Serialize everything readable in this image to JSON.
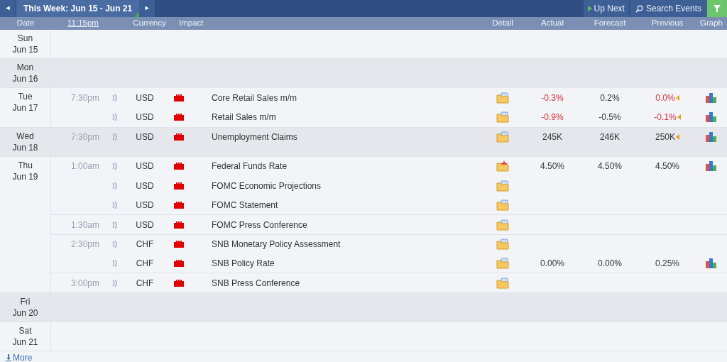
{
  "toolbar": {
    "prev": "◄",
    "week": "This Week: Jun 15 - Jun 21",
    "next": "►",
    "up_next": "Up Next",
    "search": "Search Events"
  },
  "columns": {
    "date": "Date",
    "time": "11:15pm",
    "currency": "Currency",
    "impact": "Impact",
    "detail": "Detail",
    "actual": "Actual",
    "forecast": "Forecast",
    "previous": "Previous",
    "graph": "Graph"
  },
  "days": [
    {
      "day": "Sun",
      "date": "Jun 15"
    },
    {
      "day": "Mon",
      "date": "Jun 16"
    },
    {
      "day": "Tue",
      "date": "Jun 17",
      "events": [
        {
          "time": "7:30pm",
          "currency": "USD",
          "high_impact": true,
          "title": "Core Retail Sales m/m",
          "new_detail": false,
          "actual": "-0.3%",
          "actual_worse": true,
          "forecast": "0.2%",
          "previous": "0.0%",
          "previous_worse": true,
          "revised": true,
          "graph": true
        },
        {
          "currency": "USD",
          "high_impact": true,
          "title": "Retail Sales m/m",
          "new_detail": false,
          "actual": "-0.9%",
          "actual_worse": true,
          "forecast": "-0.5%",
          "previous": "-0.1%",
          "previous_worse": true,
          "revised": true,
          "graph": true
        }
      ]
    },
    {
      "day": "Wed",
      "date": "Jun 18",
      "events": [
        {
          "time": "7:30pm",
          "currency": "USD",
          "high_impact": true,
          "title": "Unemployment Claims",
          "new_detail": false,
          "actual": "245K",
          "actual_worse": false,
          "forecast": "246K",
          "previous": "250K",
          "previous_worse": false,
          "revised": true,
          "graph": true
        }
      ]
    },
    {
      "day": "Thu",
      "date": "Jun 19",
      "events": [
        {
          "time": "1:00am",
          "currency": "USD",
          "high_impact": true,
          "title": "Federal Funds Rate",
          "new_detail": true,
          "actual": "4.50%",
          "actual_worse": false,
          "forecast": "4.50%",
          "previous": "4.50%",
          "previous_worse": false,
          "revised": false,
          "graph": true
        },
        {
          "currency": "USD",
          "high_impact": true,
          "title": "FOMC Economic Projections",
          "new_detail": false,
          "revised": false,
          "graph": false
        },
        {
          "currency": "USD",
          "high_impact": true,
          "title": "FOMC Statement",
          "new_detail": false,
          "revised": false,
          "graph": false
        },
        {
          "time": "1:30am",
          "currency": "USD",
          "high_impact": true,
          "title": "FOMC Press Conference",
          "new_detail": false,
          "revised": false,
          "graph": false
        },
        {
          "time": "2:30pm",
          "currency": "CHF",
          "high_impact": true,
          "title": "SNB Monetary Policy Assessment",
          "new_detail": false,
          "revised": false,
          "graph": false
        },
        {
          "currency": "CHF",
          "high_impact": true,
          "title": "SNB Policy Rate",
          "new_detail": false,
          "actual": "0.00%",
          "actual_worse": false,
          "forecast": "0.00%",
          "previous": "0.25%",
          "previous_worse": false,
          "revised": false,
          "graph": true
        },
        {
          "time": "3:00pm",
          "currency": "CHF",
          "high_impact": true,
          "title": "SNB Press Conference",
          "new_detail": false,
          "revised": false,
          "graph": false
        }
      ]
    },
    {
      "day": "Fri",
      "date": "Jun 20"
    },
    {
      "day": "Sat",
      "date": "Jun 21"
    }
  ],
  "more": "More"
}
